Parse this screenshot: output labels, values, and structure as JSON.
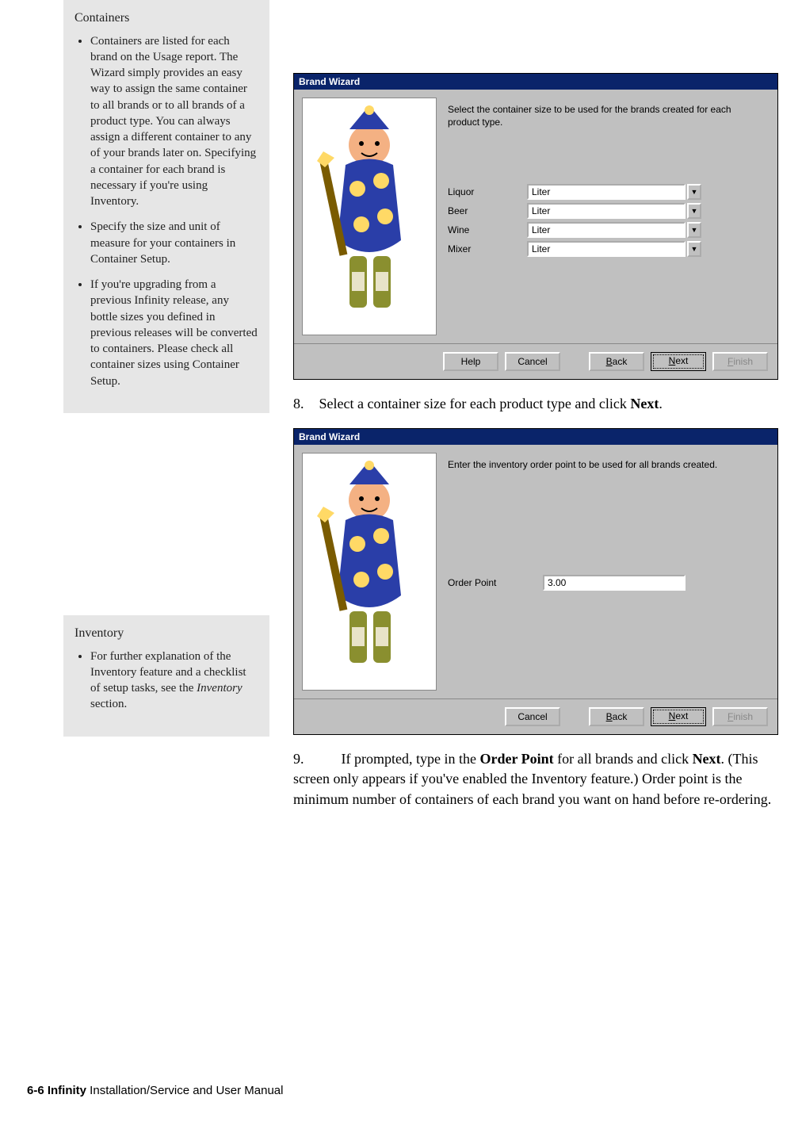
{
  "sidebar1": {
    "title": "Containers",
    "bullets": [
      "Containers are listed for each brand on the Usage report. The Wizard simply provides an easy way to assign the same container to all brands or to all brands of a product type. You can always assign a different container to any of your brands later on. Specifying a container for each brand is necessary if you're using Inventory.",
      "Specify the size and unit of measure for your containers in Container Setup.",
      "If you're upgrading from a previous Infinity release, any bottle sizes you defined in previous releases will be converted to containers. Please check all container sizes using Container Setup."
    ]
  },
  "sidebar2": {
    "title": "Inventory",
    "bullets_pre": "For further explanation of the Inventory feature and a checklist of setup tasks, see the ",
    "bullets_italic": "Inventory",
    "bullets_post": " section."
  },
  "wizard1": {
    "title": "Brand Wizard",
    "blurb": "Select the container size to be used for the brands created for each product type.",
    "rows": [
      {
        "label": "Liquor",
        "value": "Liter"
      },
      {
        "label": "Beer",
        "value": "Liter"
      },
      {
        "label": "Wine",
        "value": "Liter"
      },
      {
        "label": "Mixer",
        "value": "Liter"
      }
    ],
    "buttons": {
      "help": "Help",
      "cancel": "Cancel",
      "back": "Back",
      "next": "Next",
      "finish": "Finish"
    }
  },
  "step8": {
    "num": "8.",
    "text_pre": "Select a container size for each product type and click ",
    "text_bold": "Next",
    "text_post": "."
  },
  "wizard2": {
    "title": "Brand Wizard",
    "blurb": "Enter the inventory order point to be used for all brands created.",
    "row": {
      "label": "Order Point",
      "value": "3.00"
    },
    "buttons": {
      "cancel": "Cancel",
      "back": "Back",
      "next": "Next",
      "finish": "Finish"
    }
  },
  "step9": {
    "num": "9.",
    "pre": "If prompted, type in the ",
    "b1": "Order Point",
    "mid": " for all brands and click ",
    "b2": "Next",
    "post": ". (This screen only appears if you've enabled the Inventory feature.) Order point is the minimum number of containers of each brand you want on hand before re-ordering."
  },
  "footer": {
    "bold": "6-6 Infinity",
    "rest": " Installation/Service and User Manual"
  }
}
